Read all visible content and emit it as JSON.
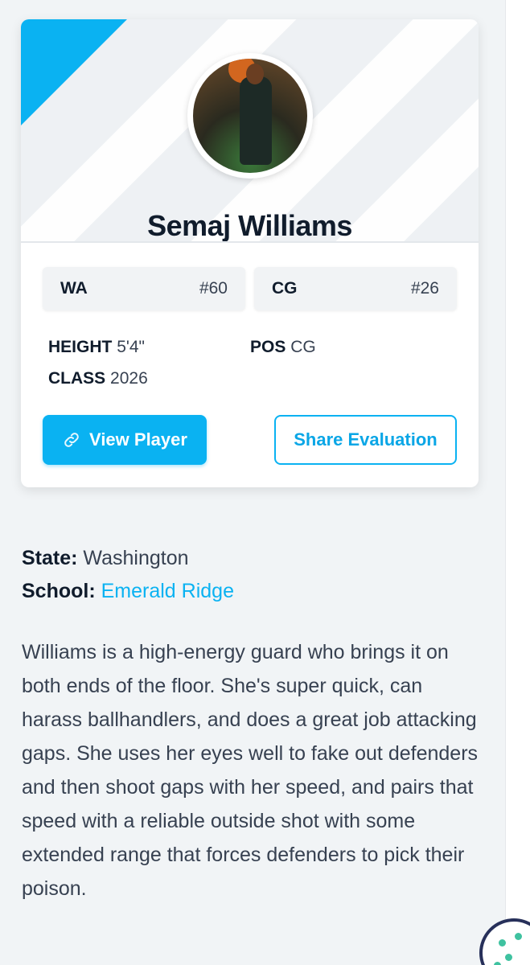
{
  "player": {
    "name": "Semaj Williams",
    "state_rank_label": "WA",
    "state_rank": "#60",
    "position_rank_label": "CG",
    "position_rank": "#26",
    "height_label": "HEIGHT",
    "height": "5'4\"",
    "position_label": "POS",
    "position": "CG",
    "class_label": "CLASS",
    "class_year": "2026"
  },
  "actions": {
    "view_player": "View Player",
    "share_evaluation": "Share Evaluation"
  },
  "details": {
    "state_label": "State:",
    "state": "Washington",
    "school_label": "School:",
    "school": "Emerald Ridge"
  },
  "bio": "Williams is a high-energy guard who brings it on both ends of the floor. She's super quick, can harass ballhandlers, and does a great job attacking gaps. She uses her eyes well to fake out defenders and then shoot gaps with her speed, and pairs that speed with a reliable outside shot with some extended range that forces defenders to pick their poison.",
  "colors": {
    "accent": "#0ab2f2",
    "heading": "#101c2c",
    "background": "#f1f4f6"
  },
  "icons": {
    "view_player": "link-icon",
    "cookie": "cookie-icon"
  }
}
